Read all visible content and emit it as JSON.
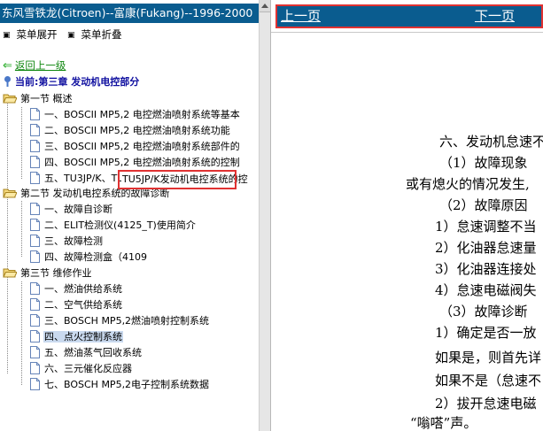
{
  "left": {
    "title": "东风雪铁龙(Citroen)--富康(Fukang)--1996-2000",
    "menu": {
      "expand": "菜单展开",
      "collapse": "菜单折叠"
    },
    "back_link": "返回上一级",
    "current": "当前:第三章 发动机电控部分",
    "tree": {
      "s1": {
        "label": "第一节 概述",
        "items": [
          "一、BOSCII MP5,2 电控燃油喷射系统等基本",
          "二、BOSCII MP5,2 电控燃油喷射系统功能",
          "三、BOSCII MP5,2 电控燃油喷射系统部件的",
          "四、BOSCII MP5,2 电控燃油喷射系统的控制",
          "五、TU3JP/K、TU5JP/K发动机电控系统的控制"
        ]
      },
      "s2": {
        "label": "第二节 发动机电控系统的故障诊断",
        "items": [
          "一、故障自诊断",
          "二、ELIT检测仪(4125_T)使用简介",
          "三、故障检测",
          "四、故障检测盒（4109"
        ]
      },
      "s3": {
        "label": "第三节 维修作业",
        "items": [
          "一、燃油供给系统",
          "二、空气供给系统",
          "三、BOSCH MP5,2燃油喷射控制系统",
          "四、点火控制系统",
          "五、燃油蒸气回收系统",
          "六、三元催化反应器",
          "七、BOSCH MP5,2电子控制系统数据"
        ]
      }
    },
    "overlay_text": "TU5JP/K发动机电控系统的控"
  },
  "nav": {
    "prev": "上一页",
    "next": "下一页"
  },
  "document": {
    "lines": [
      "六、发动机怠速不",
      "（1）故障现象",
      "或有熄火的情况发生,",
      "（2）故障原因",
      "1）怠速调整不当",
      "2）化油器怠速量",
      "3）化油器连接处",
      "4）怠速电磁阀失",
      "（3）故障诊断",
      "1）确定是否一放",
      "如果是，则首先详",
      "如果不是（怠速不",
      "2）拔开怠速电磁",
      "“嗡嗒”声。"
    ]
  },
  "colors": {
    "header_bg": "#0a5c8f",
    "highlight_border": "#e03232",
    "back_link": "#118811",
    "current_text": "#1010a0"
  }
}
